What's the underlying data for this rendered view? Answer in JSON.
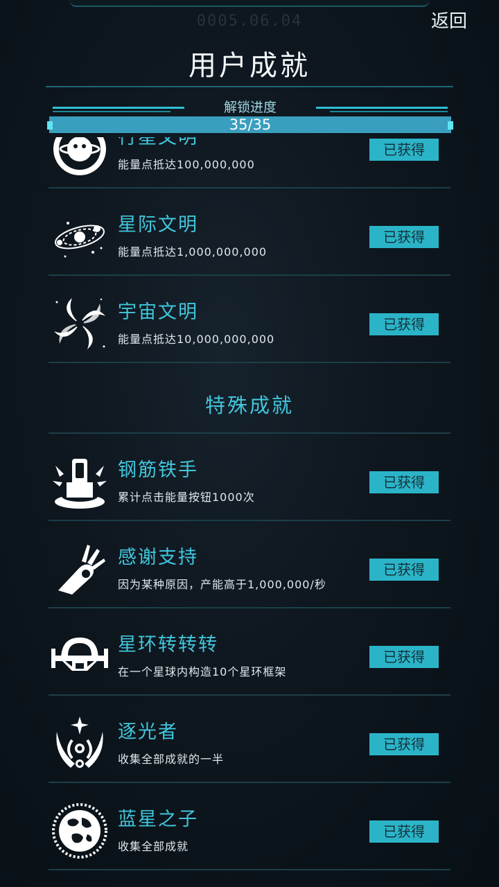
{
  "header": {
    "date": "0005.06.04",
    "back_label": "返回",
    "title": "用户成就"
  },
  "progress": {
    "label": "解锁进度",
    "value_text": "35/35",
    "fraction": 1.0
  },
  "achievements_top": [
    {
      "name": "行星文明",
      "desc": "能量点抵达100,000,000",
      "status": "已获得",
      "icon": "planet-icon"
    },
    {
      "name": "星际文明",
      "desc": "能量点抵达1,000,000,000",
      "status": "已获得",
      "icon": "solar-system-icon"
    },
    {
      "name": "宇宙文明",
      "desc": "能量点抵达10,000,000,000",
      "status": "已获得",
      "icon": "galaxy-icon"
    }
  ],
  "special_section": {
    "title": "特殊成就"
  },
  "achievements_special": [
    {
      "name": "钢筋铁手",
      "desc": "累计点击能量按钮1000次",
      "status": "已获得",
      "icon": "button-press-icon"
    },
    {
      "name": "感谢支持",
      "desc": "因为某种原因，产能高于1,000,000/秒",
      "status": "已获得",
      "icon": "ok-hand-icon"
    },
    {
      "name": "星环转转转",
      "desc": "在一个星球内构造10个星环框架",
      "status": "已获得",
      "icon": "ring-station-icon"
    },
    {
      "name": "逐光者",
      "desc": "收集全部成就的一半",
      "status": "已获得",
      "icon": "light-chaser-icon"
    },
    {
      "name": "蓝星之子",
      "desc": "收集全部成就",
      "status": "已获得",
      "icon": "blue-planet-icon"
    }
  ],
  "colors": {
    "accent": "#41c6dc",
    "button_bg": "#2bb4c8",
    "background": "#0e161e"
  }
}
